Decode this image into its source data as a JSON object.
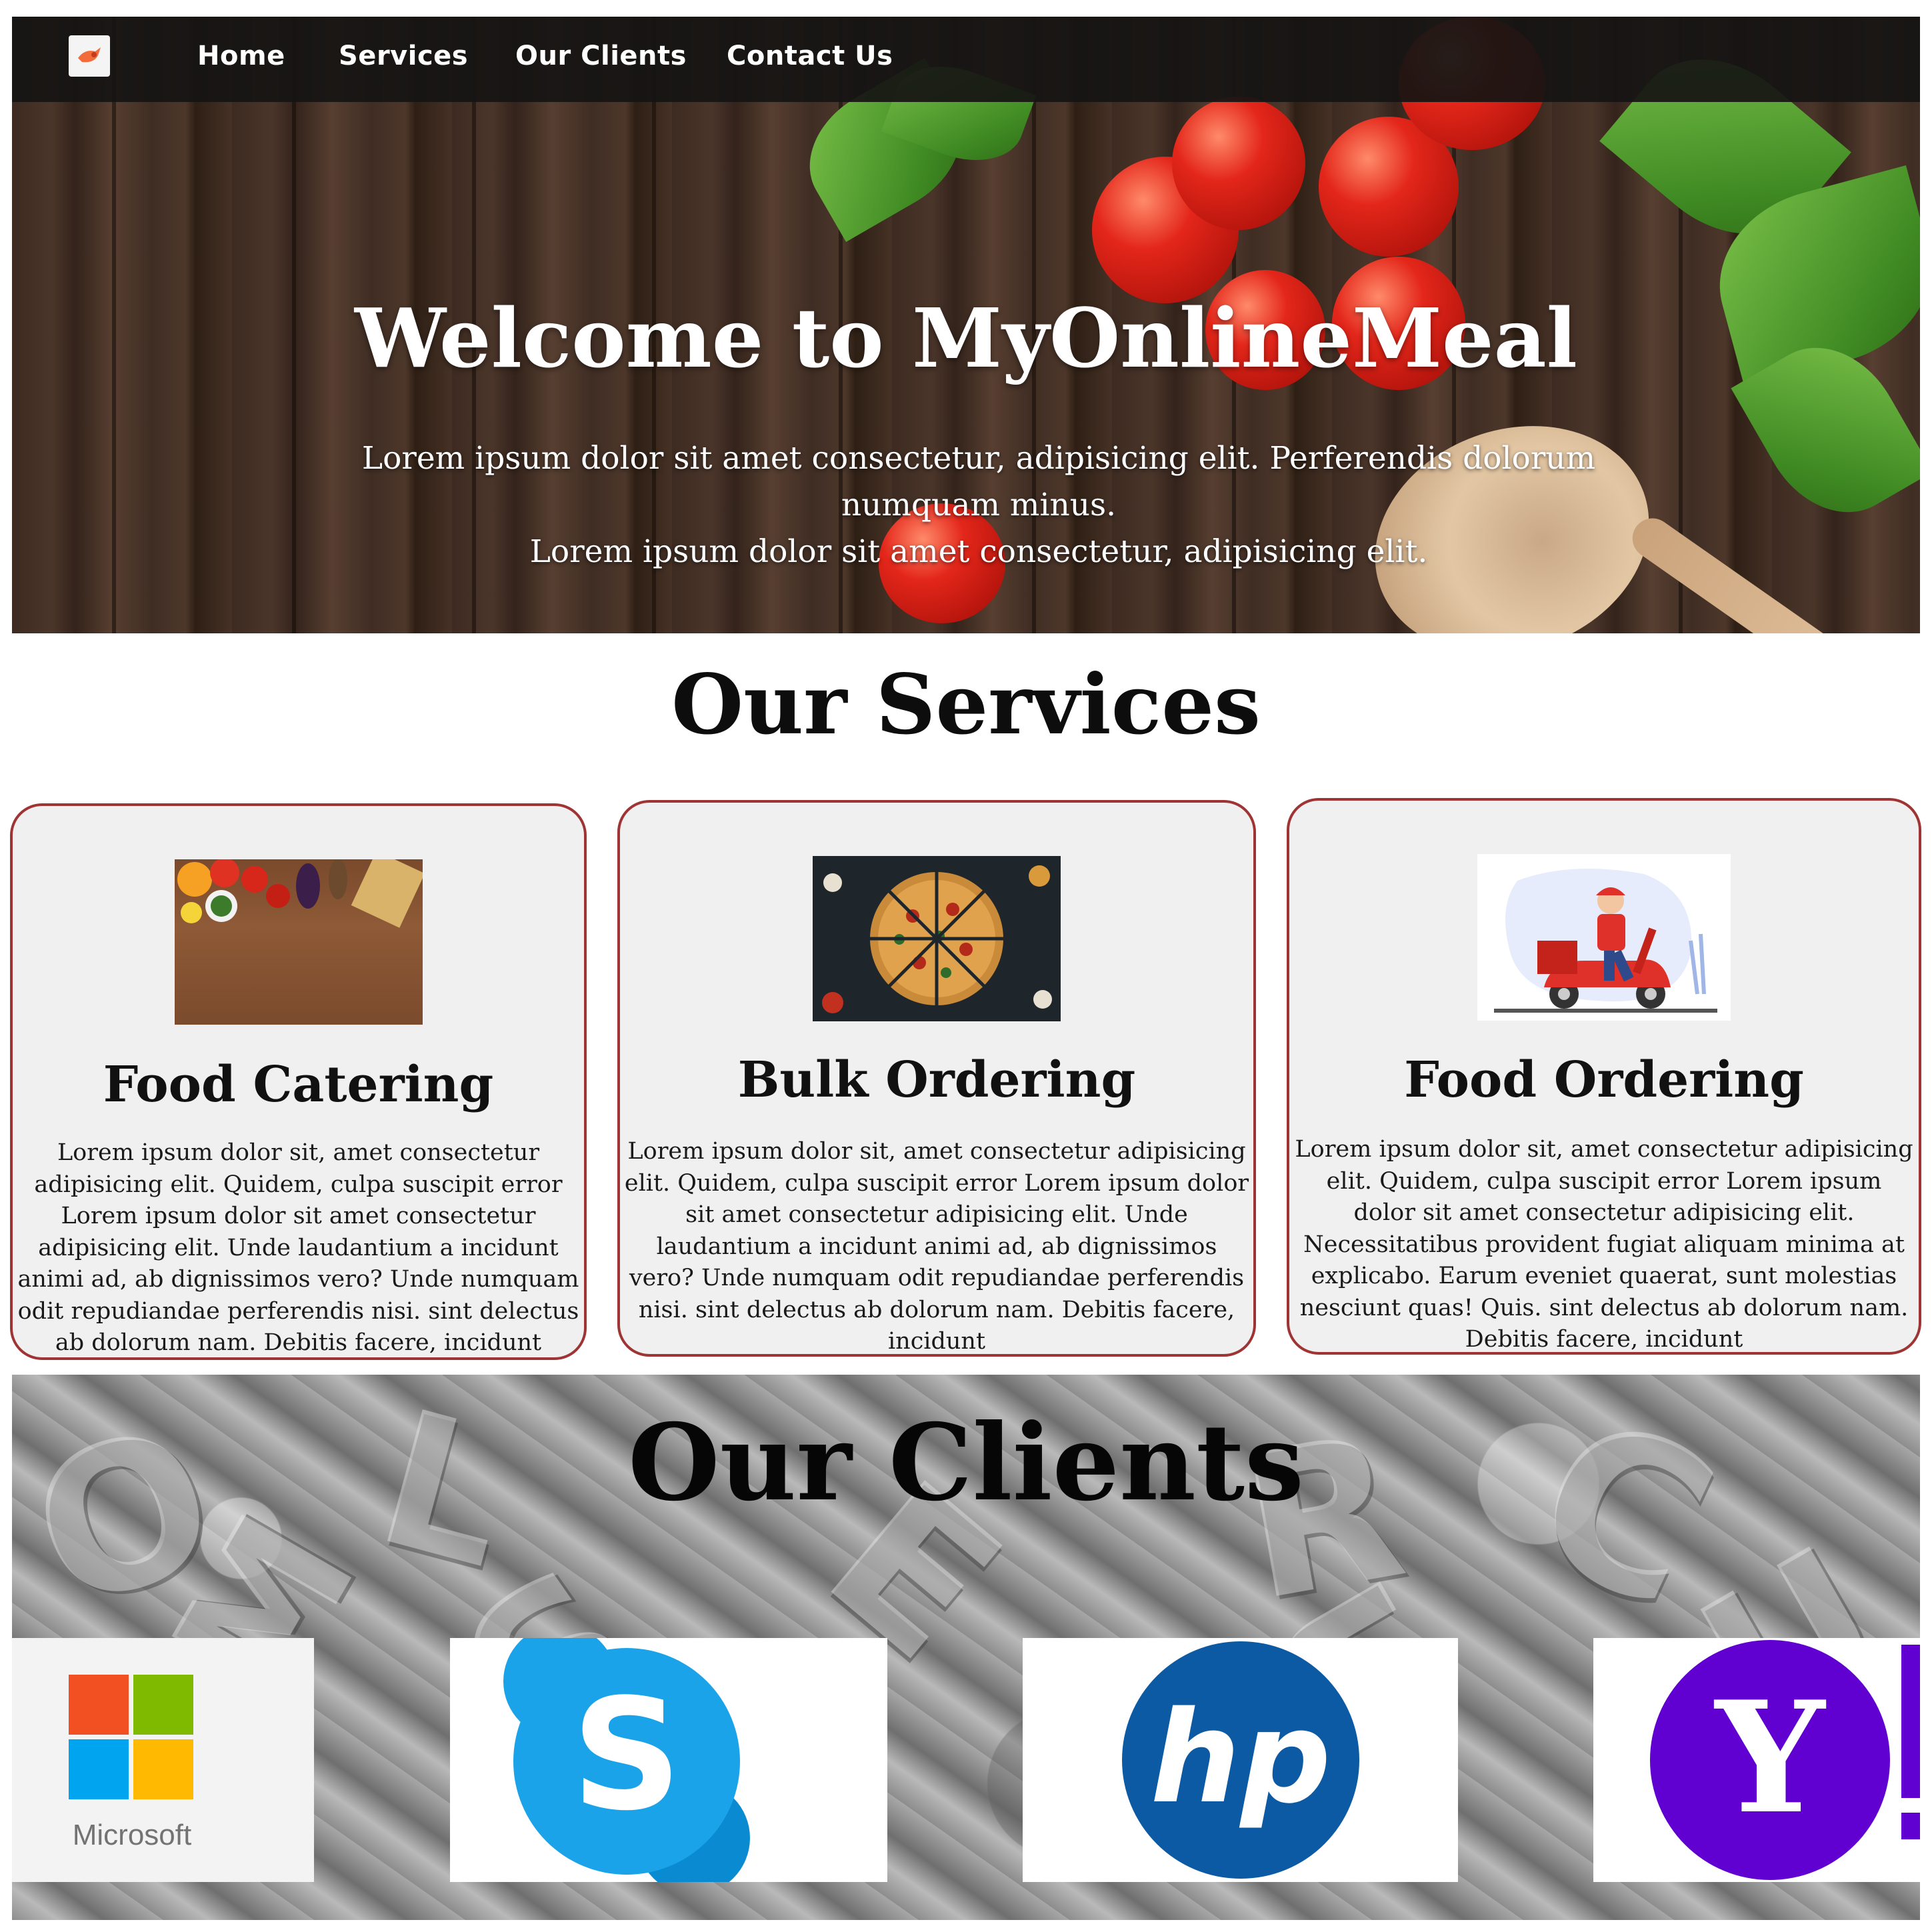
{
  "nav": {
    "items": [
      "Home",
      "Services",
      "Our Clients",
      "Contact Us"
    ]
  },
  "hero": {
    "title": "Welcome to MyOnlineMeal",
    "subtitle_line1": "Lorem ipsum dolor sit amet consectetur, adipisicing elit. Perferendis dolorum numquam minus.",
    "subtitle_line2": "Lorem ipsum dolor sit amet consectetur, adipisicing elit."
  },
  "services": {
    "title": "Our Services",
    "cards": [
      {
        "title": "Food Catering",
        "text": "Lorem ipsum dolor sit, amet consectetur adipisicing elit. Quidem, culpa suscipit error Lorem ipsum dolor sit amet consectetur adipisicing elit. Unde laudantium a incidunt animi ad, ab dignissimos vero? Unde numquam odit repudiandae perferendis nisi. sint delectus ab dolorum nam. Debitis facere, incidunt"
      },
      {
        "title": "Bulk Ordering",
        "text": "Lorem ipsum dolor sit, amet consectetur adipisicing elit. Quidem, culpa suscipit error Lorem ipsum dolor sit amet consectetur adipisicing elit. Unde laudantium a incidunt animi ad, ab dignissimos vero? Unde numquam odit repudiandae perferendis nisi. sint delectus ab dolorum nam. Debitis facere, incidunt"
      },
      {
        "title": "Food Ordering",
        "text": "Lorem ipsum dolor sit, amet consectetur adipisicing elit. Quidem, culpa suscipit error Lorem ipsum dolor sit amet consectetur adipisicing elit. Necessitatibus provident fugiat aliquam minima at explicabo. Earum eveniet quaerat, sunt molestias nesciunt quas! Quis. sint delectus ab dolorum nam. Debitis facere, incidunt"
      }
    ]
  },
  "clients": {
    "title": "Our Clients",
    "logos": [
      {
        "name": "Microsoft",
        "icon": "microsoft-logo"
      },
      {
        "name": "Skype",
        "icon": "skype-logo"
      },
      {
        "name": "HP",
        "icon": "hp-logo"
      },
      {
        "name": "Yahoo",
        "icon": "yahoo-logo"
      }
    ]
  },
  "colors": {
    "nav_bg": "#161413",
    "card_border": "#9e3434",
    "card_bg": "#f0f0f0",
    "skype_blue": "#1aa3e8",
    "hp_blue": "#0b5aa3",
    "yahoo_purple": "#6001d2"
  }
}
